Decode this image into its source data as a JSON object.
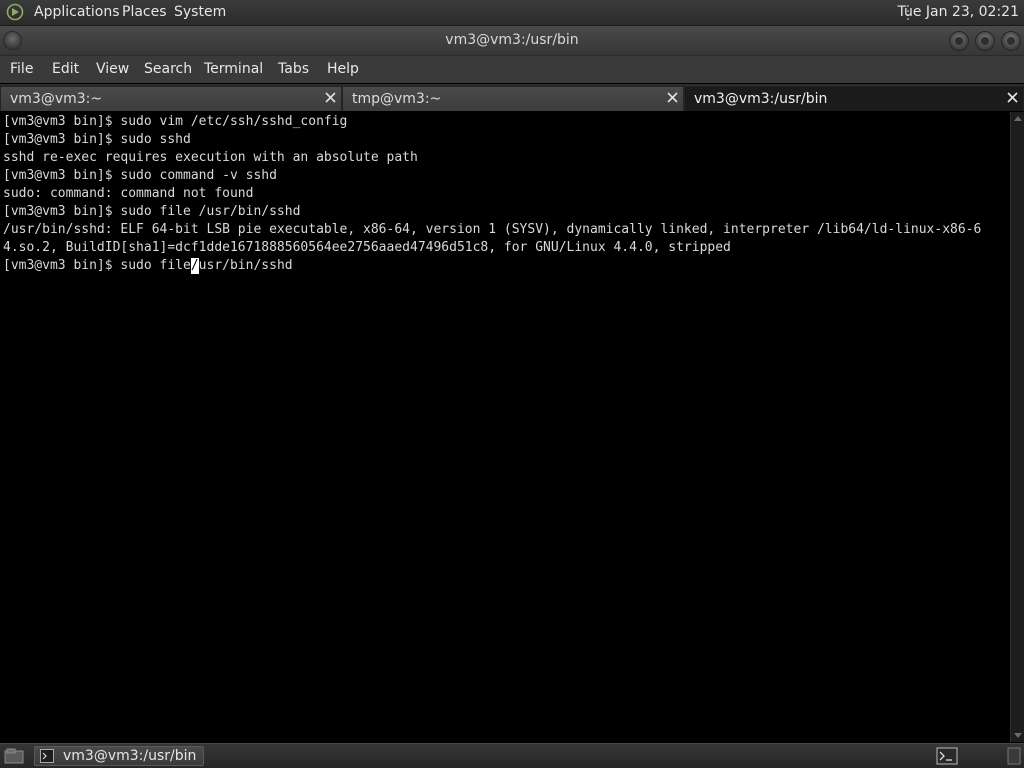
{
  "top_panel": {
    "logo_icon": "distro-logo-icon",
    "menus": [
      "Applications",
      "Places",
      "System"
    ],
    "clock": "Tue Jan 23, 02:21"
  },
  "window": {
    "title": "vm3@vm3:/usr/bin",
    "menu": [
      "File",
      "Edit",
      "View",
      "Search",
      "Terminal",
      "Tabs",
      "Help"
    ],
    "tabs": [
      {
        "label": "vm3@vm3:~",
        "active": false
      },
      {
        "label": "tmp@vm3:~",
        "active": false
      },
      {
        "label": "vm3@vm3:/usr/bin",
        "active": true
      }
    ]
  },
  "terminal": {
    "lines": [
      "[vm3@vm3 bin]$ sudo vim /etc/ssh/sshd_config",
      "[vm3@vm3 bin]$ sudo sshd",
      "sshd re-exec requires execution with an absolute path",
      "[vm3@vm3 bin]$ sudo command -v sshd",
      "sudo: command: command not found",
      "[vm3@vm3 bin]$ sudo file /usr/bin/sshd",
      "/usr/bin/sshd: ELF 64-bit LSB pie executable, x86-64, version 1 (SYSV), dynamically linked, interpreter /lib64/ld-linux-x86-6",
      "4.so.2, BuildID[sha1]=dcf1dde1671888560564ee2756aaed47496d51c8, for GNU/Linux 4.4.0, stripped"
    ],
    "current_prompt": "[vm3@vm3 bin]$ sudo file",
    "cursor_char": "/",
    "current_after_cursor": "usr/bin/sshd"
  },
  "bottom_panel": {
    "task_label": "vm3@vm3:/usr/bin"
  },
  "colors": {
    "panel": "#2e2e2e",
    "terminal_bg": "#000000",
    "terminal_fg": "#d9d9d9"
  }
}
